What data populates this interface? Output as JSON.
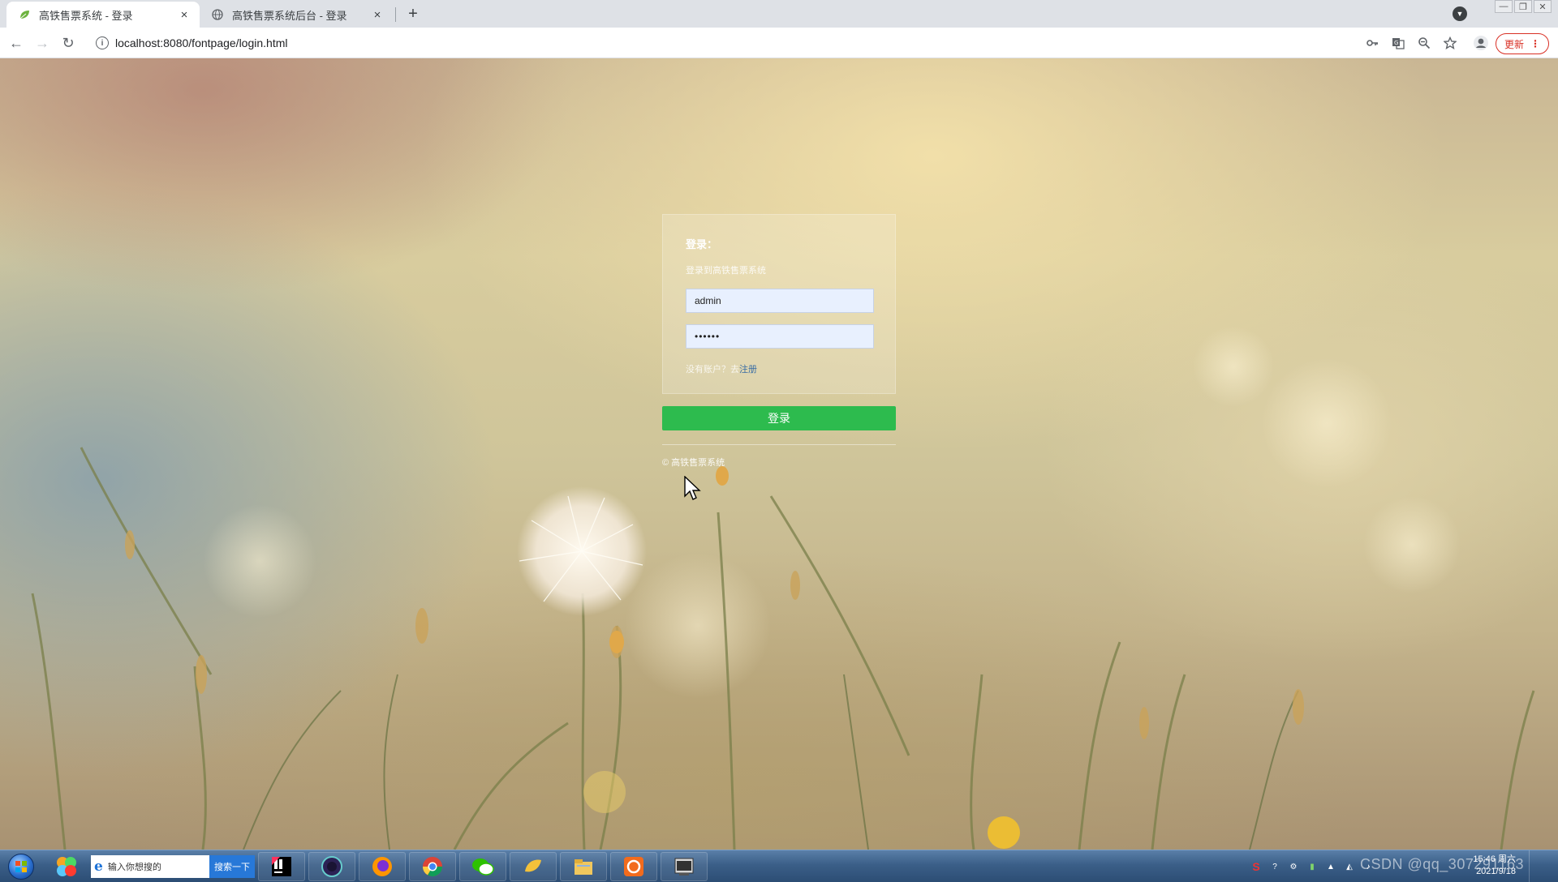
{
  "browser": {
    "tabs": [
      {
        "title": "高铁售票系统 - 登录",
        "active": true
      },
      {
        "title": "高铁售票系统后台 - 登录",
        "active": false
      }
    ],
    "new_tab_symbol": "+",
    "url": "localhost:8080/fontpage/login.html",
    "update_label": "更新",
    "close_symbol": "×"
  },
  "login": {
    "title": "登录：",
    "subtitle": "登录到高铁售票系统",
    "username": "admin",
    "password_mask": "••••••",
    "register_prompt": "没有账户？去",
    "register_link": "注册",
    "submit_label": "登录",
    "copyright": "© 高铁售票系统"
  },
  "taskbar": {
    "search_placeholder": "输入你想搜的",
    "search_button": "搜索一下",
    "clock_time": "15:46 周六",
    "clock_date": "2021/9/18",
    "watermark": "CSDN @qq_307291163"
  },
  "colors": {
    "login_button": "#2dbb4e",
    "link": "#3a6ea5",
    "update": "#d93025"
  }
}
